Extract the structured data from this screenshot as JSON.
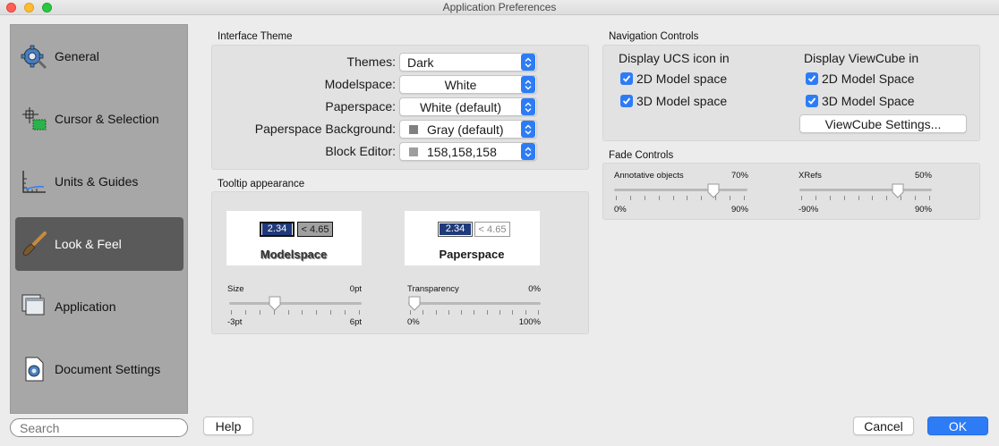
{
  "window": {
    "title": "Application Preferences"
  },
  "sidebar": {
    "items": [
      {
        "label": "General",
        "icon": "gear-icon"
      },
      {
        "label": "Cursor & Selection",
        "icon": "cursor-selection-icon"
      },
      {
        "label": "Units & Guides",
        "icon": "ruler-icon"
      },
      {
        "label": "Look & Feel",
        "icon": "paintbrush-icon",
        "active": true
      },
      {
        "label": "Application",
        "icon": "windows-icon"
      },
      {
        "label": "Document Settings",
        "icon": "document-gear-icon"
      }
    ],
    "search_placeholder": "Search"
  },
  "interface_theme": {
    "section_label": "Interface Theme",
    "rows": [
      {
        "label": "Themes:",
        "value": "Dark"
      },
      {
        "label": "Modelspace:",
        "value": "White"
      },
      {
        "label": "Paperspace:",
        "value": "White (default)"
      },
      {
        "label": "Paperspace Background:",
        "value": "Gray (default)",
        "swatch": "#808080"
      },
      {
        "label": "Block Editor:",
        "value": "158,158,158",
        "swatch": "#9e9e9e"
      }
    ]
  },
  "tooltip_appearance": {
    "section_label": "Tooltip appearance",
    "modelspace": {
      "label": "Modelspace",
      "tip_a": "2.34",
      "tip_b": "< 4.65",
      "size_slider": {
        "label": "Size",
        "value": "0pt",
        "min": "-3pt",
        "max": "6pt",
        "fraction": 0.333
      }
    },
    "paperspace": {
      "label": "Paperspace",
      "tip_a": "2.34",
      "tip_b": "< 4.65",
      "transparency_slider": {
        "label": "Transparency",
        "value": "0%",
        "min": "0%",
        "max": "100%",
        "fraction": 0.0
      }
    }
  },
  "navigation_controls": {
    "section_label": "Navigation Controls",
    "ucs": {
      "heading": "Display UCS icon in",
      "options": [
        {
          "label": "2D Model space",
          "checked": true
        },
        {
          "label": "3D Model space",
          "checked": true
        }
      ]
    },
    "viewcube": {
      "heading": "Display ViewCube in",
      "options": [
        {
          "label": "2D Model Space",
          "checked": true
        },
        {
          "label": "3D Model Space",
          "checked": true
        }
      ],
      "settings_button": "ViewCube Settings..."
    }
  },
  "fade_controls": {
    "section_label": "Fade Controls",
    "annotative": {
      "label": "Annotative objects",
      "value": "70%",
      "min": "0%",
      "max": "90%",
      "fraction": 0.778
    },
    "xrefs": {
      "label": "XRefs",
      "value": "50%",
      "min": "-90%",
      "max": "90%",
      "fraction": 0.778
    }
  },
  "footer": {
    "help": "Help",
    "cancel": "Cancel",
    "ok": "OK"
  },
  "colors": {
    "accent": "#2d7cf6",
    "sidebar_bg": "#a7a7a7",
    "sidebar_active": "#5a5a5a",
    "tooltip_dark": "#1f3a7a"
  }
}
